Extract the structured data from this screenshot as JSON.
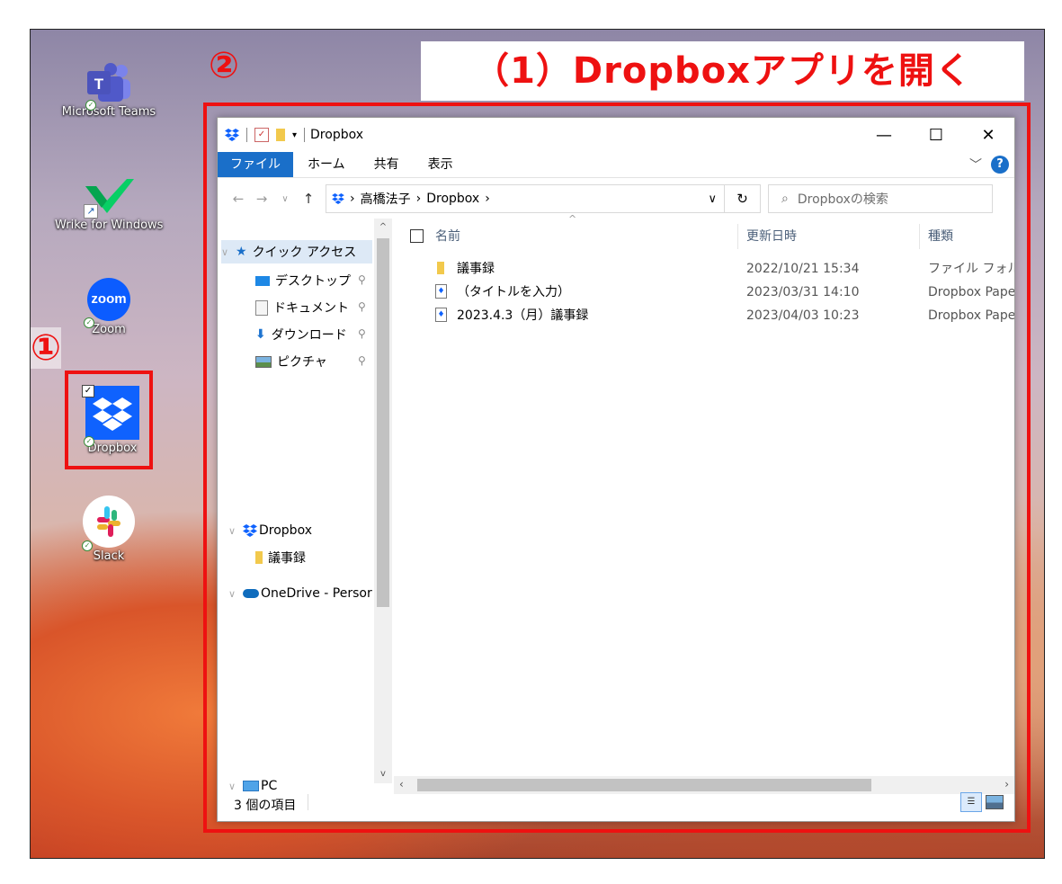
{
  "annotations": {
    "step1": "①",
    "step2": "②",
    "title": "（1）Dropboxアプリを開く"
  },
  "desktop_icons": [
    {
      "id": "teams",
      "label": "Microsoft Teams"
    },
    {
      "id": "wrike",
      "label": "Wrike for Windows"
    },
    {
      "id": "zoom",
      "label": "Zoom",
      "logo_text": "zoom"
    },
    {
      "id": "dropbox",
      "label": "Dropbox"
    },
    {
      "id": "slack",
      "label": "Slack"
    }
  ],
  "explorer": {
    "title": "Dropbox",
    "ribbon_tabs": [
      "ファイル",
      "ホーム",
      "共有",
      "表示"
    ],
    "breadcrumb": [
      "高橋法子",
      "Dropbox"
    ],
    "search_placeholder": "Dropboxの検索",
    "nav": {
      "quick_access": "クイック アクセス",
      "items": [
        "デスクトップ",
        "ドキュメント",
        "ダウンロード",
        "ピクチャ"
      ],
      "dropbox": "Dropbox",
      "dropbox_child": "議事録",
      "onedrive": "OneDrive - Persor",
      "pc": "PC"
    },
    "columns": {
      "name": "名前",
      "date": "更新日時",
      "type": "種類"
    },
    "files": [
      {
        "name": "議事録",
        "date": "2022/10/21 15:34",
        "type": "ファイル フォルダー",
        "kind": "folder"
      },
      {
        "name": "（タイトルを入力）",
        "date": "2023/03/31 14:10",
        "type": "Dropbox Paper",
        "kind": "paper"
      },
      {
        "name": "2023.4.3（月）議事録",
        "date": "2023/04/03 10:23",
        "type": "Dropbox Paper",
        "kind": "paper"
      }
    ],
    "status": "3 個の項目"
  },
  "colors": {
    "annotation_red": "#ee1111",
    "ribbon_blue": "#1a6fc9",
    "dropbox_blue": "#0f62fe"
  }
}
